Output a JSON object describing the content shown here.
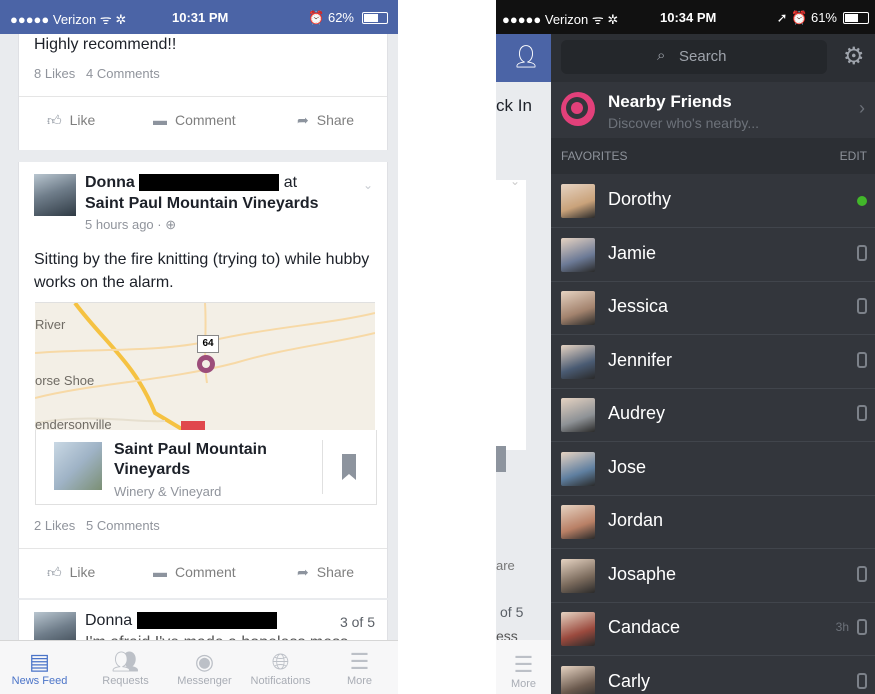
{
  "left": {
    "status": {
      "carrier": "●●●●● Verizon ᯤ ✲",
      "time": "10:31 PM",
      "battery": "⏰ 62%",
      "battery_level": 0.62
    },
    "post0": {
      "text": "Highly recommend!!",
      "likes": "8 Likes",
      "comments": "4 Comments"
    },
    "actions": {
      "like": "Like",
      "comment": "Comment",
      "share": "Share"
    },
    "post1": {
      "author": "Donna",
      "at": "at",
      "place": "Saint Paul Mountain Vineyards",
      "time": "5 hours ago · ",
      "text": "Sitting by the fire knitting (trying to) while hubby works on the alarm.",
      "map_labels": {
        "river": "River",
        "horse": "orse Shoe",
        "highway": "64",
        "town": "endersonville"
      },
      "place_card": {
        "name": "Saint Paul Mountain Vineyards",
        "category": "Winery & Vineyard"
      },
      "likes": "2 Likes",
      "comments": "5 Comments"
    },
    "post2": {
      "author": "Donna",
      "counter": "3 of 5",
      "text": "I'm afraid I've made a hopeless mess"
    },
    "tabs": [
      "News Feed",
      "Requests",
      "Messenger",
      "Notifications",
      "More"
    ]
  },
  "right": {
    "status": {
      "carrier": "●●●●● Verizon ᯤ ✲",
      "time": "10:34 PM",
      "battery": "➚ ⏰ 61%",
      "battery_level": 0.61
    },
    "feed_edge": {
      "checkin": "ck In",
      "share": "are",
      "counter": "of 5",
      "snippet": "ess",
      "more": "More"
    },
    "search": {
      "placeholder": "Search"
    },
    "nearby": {
      "title": "Nearby Friends",
      "subtitle": "Discover who's nearby..."
    },
    "section": {
      "title": "FAVORITES",
      "edit": "EDIT"
    },
    "friends": [
      {
        "name": "Dorothy",
        "status": "online",
        "color": "#c9a27a"
      },
      {
        "name": "Jamie",
        "status": "mobile",
        "color": "#6c7a96"
      },
      {
        "name": "Jessica",
        "status": "mobile",
        "color": "#a3836e"
      },
      {
        "name": "Jennifer",
        "status": "mobile",
        "color": "#4a5b73"
      },
      {
        "name": "Audrey",
        "status": "mobile",
        "color": "#8e9296"
      },
      {
        "name": "Jose",
        "status": "",
        "color": "#5f7fa0"
      },
      {
        "name": "Jordan",
        "status": "",
        "color": "#b98066"
      },
      {
        "name": "Josaphe",
        "status": "mobile",
        "color": "#7a6a5c"
      },
      {
        "name": "Candace",
        "status": "mobile",
        "time": "3h",
        "color": "#9b4a3e"
      },
      {
        "name": "Carly",
        "status": "mobile",
        "color": "#6b5a4e"
      }
    ]
  }
}
